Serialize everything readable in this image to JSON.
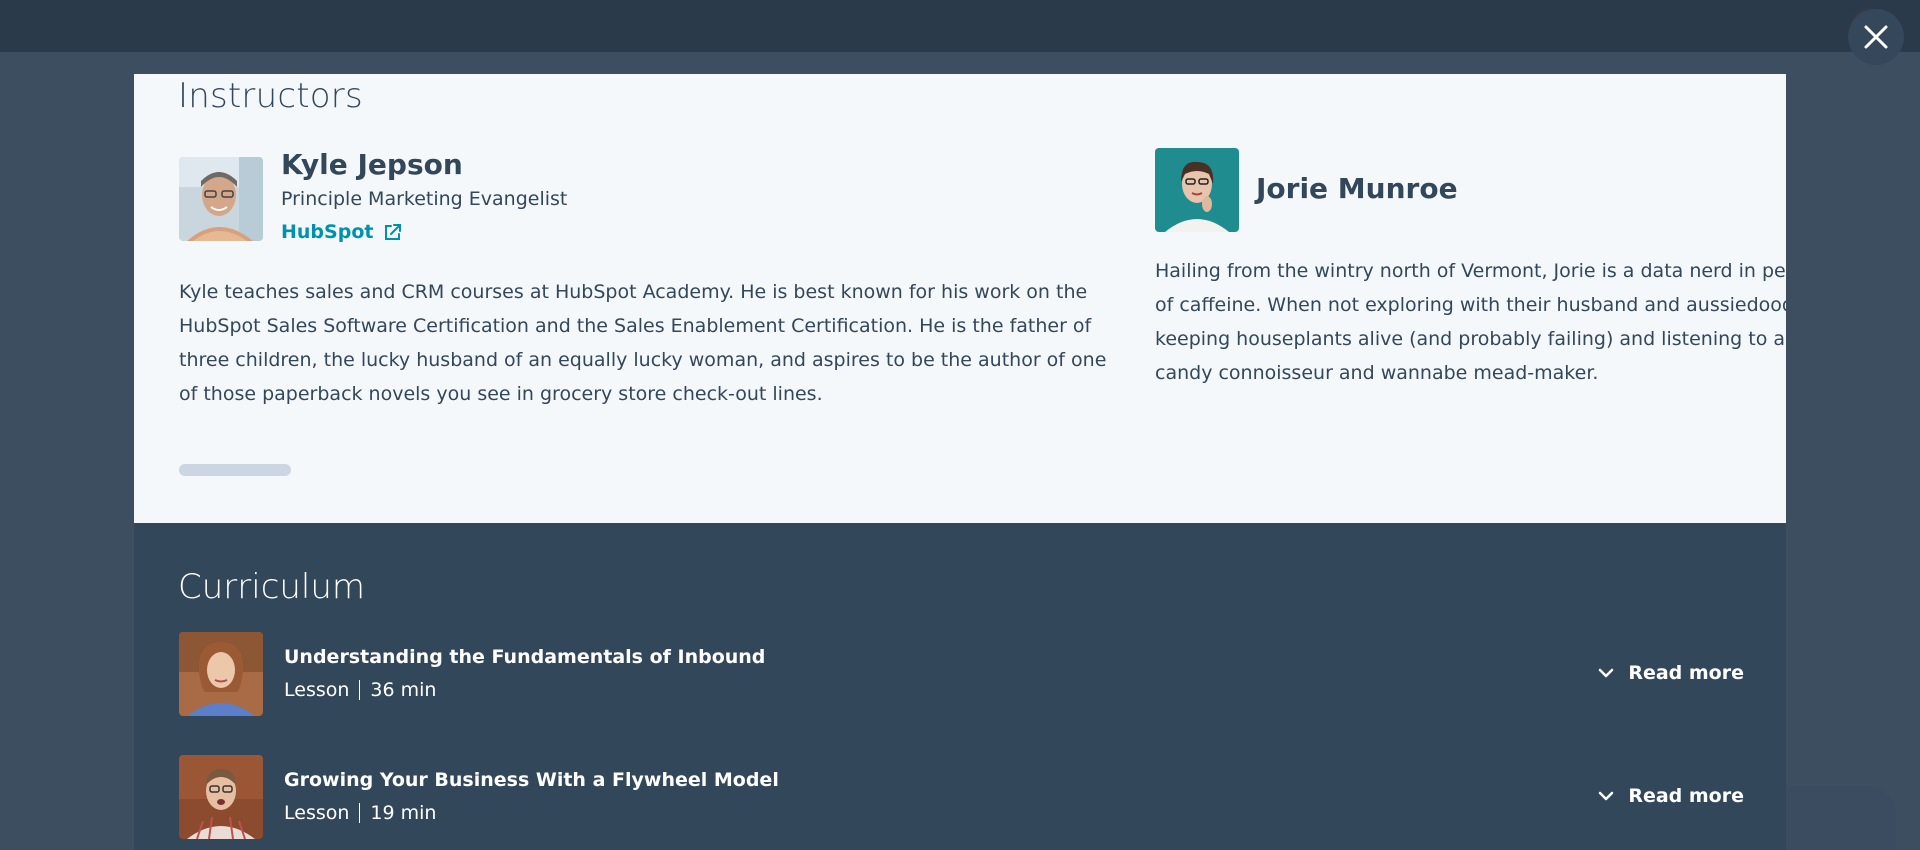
{
  "modal": {
    "instructors_title": "Instructors",
    "instructors": [
      {
        "name": "Kyle Jepson",
        "role": "Principle Marketing Evangelist",
        "company": "HubSpot",
        "bio": "Kyle teaches sales and CRM courses at HubSpot Academy. He is best known for his work on the HubSpot Sales Software Certification and the Sales Enablement Certification. He is the father of three children, the lucky husband of an equally lucky woman, and aspires to be the author of one of those paperback novels you see in grocery store check-out lines."
      },
      {
        "name": "Jorie Munroe",
        "bio": "Hailing from the wintry north of Vermont, Jorie is a data nerd in perpetual pursuit of caffeine. When not exploring with their husband and aussiedoodle, they are keeping houseplants alive (and probably failing) and listening to a podcast about candy connoisseur and wannabe mead-maker."
      }
    ],
    "curriculum_title": "Curriculum",
    "lessons": [
      {
        "title": "Understanding the Fundamentals of Inbound",
        "type": "Lesson",
        "duration": "36 min",
        "action": "Read more"
      },
      {
        "title": "Growing Your Business With a Flywheel Model",
        "type": "Lesson",
        "duration": "19 min",
        "action": "Read more"
      }
    ]
  },
  "colors": {
    "overlay": "#3d4e61",
    "panel_light": "#f5f8fa",
    "panel_dark": "#33475b",
    "link": "#0091ae"
  }
}
